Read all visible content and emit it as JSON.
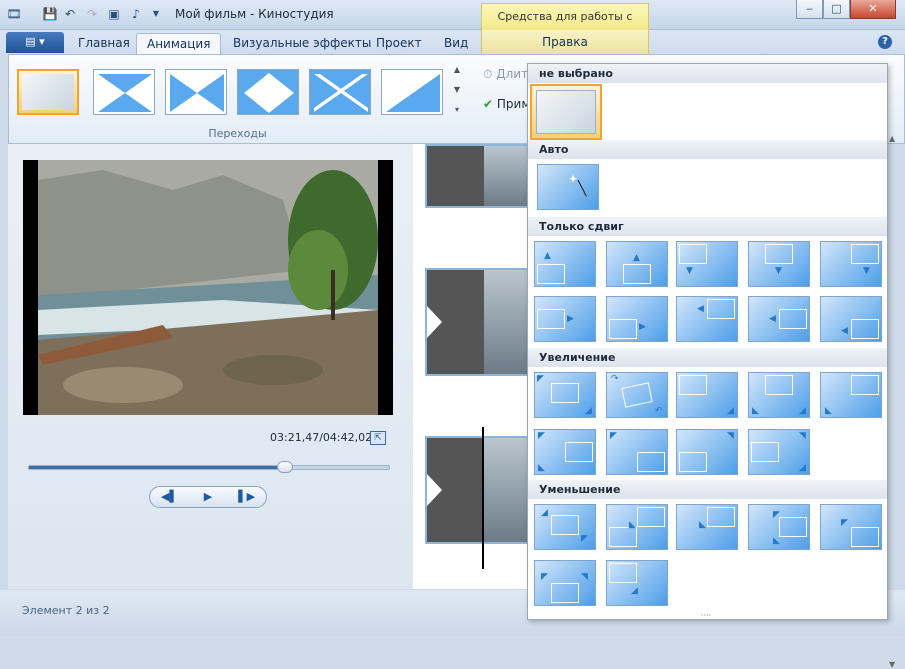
{
  "window": {
    "title": "Мой фильм - Киностудия",
    "context_tab": "Средства для работы с видео",
    "controls": [
      "‒",
      "□",
      "✕"
    ]
  },
  "ribbon_tabs": [
    {
      "label": "Главная",
      "active": false
    },
    {
      "label": "Анимация",
      "active": true
    },
    {
      "label": "Визуальные эффекты",
      "active": false
    },
    {
      "label": "Проект",
      "active": false
    },
    {
      "label": "Вид",
      "active": false
    },
    {
      "label": "Правка",
      "active": false,
      "contextual": true
    }
  ],
  "ribbon": {
    "transitions_group_label": "Переходы",
    "duration_label": "Длител",
    "apply_label": "Приме"
  },
  "preview": {
    "timecode": "03:21,47/04:42,02",
    "seek_fraction": 0.71
  },
  "status": {
    "text": "Элемент 2 из 2"
  },
  "dropdown": {
    "categories": [
      {
        "label": "не выбрано"
      },
      {
        "label": "Авто"
      },
      {
        "label": "Только сдвиг"
      },
      {
        "label": "Увеличение"
      },
      {
        "label": "Уменьшение"
      }
    ]
  },
  "colors": {
    "accent": "#2f62a8",
    "selection": "#f0a431",
    "tile_blue": "#4d9ee9"
  }
}
